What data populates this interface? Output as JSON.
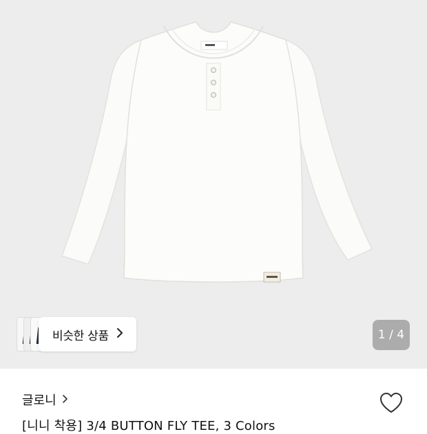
{
  "gallery": {
    "similar_products_label": "비슷한 상품",
    "page_indicator": "1 / 4"
  },
  "product": {
    "brand": "글로니",
    "title": "[니니 착용] 3/4 BUTTON FLY TEE, 3 Colors"
  },
  "icons": {
    "similar_chevron": "chevron-right-icon",
    "brand_chevron": "chevron-right-icon",
    "wishlist": "heart-outline-icon"
  },
  "colors": {
    "gallery_background": "#ededed",
    "pager_background": "#767676"
  }
}
